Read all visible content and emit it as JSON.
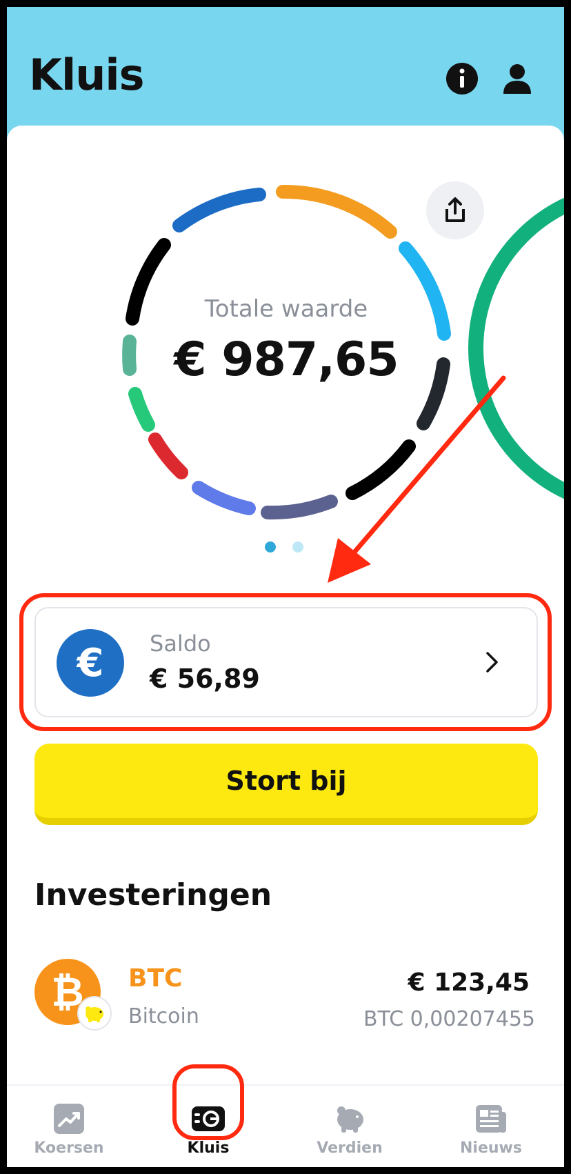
{
  "header": {
    "title": "Kluis",
    "icons": [
      "info-icon",
      "user-icon"
    ]
  },
  "portfolio": {
    "total_label": "Totale waarde",
    "total_value": "€ 987,65",
    "carousel_pages": 2,
    "carousel_active": 1
  },
  "saldo": {
    "label": "Saldo",
    "value": "€ 56,89",
    "currency_symbol": "€"
  },
  "deposit_button": "Stort bij",
  "investments": {
    "title": "Investeringen",
    "items": [
      {
        "symbol": "BTC",
        "name": "Bitcoin",
        "value": "€ 123,45",
        "amount": "BTC 0,00207455",
        "logo_glyph": "₿"
      }
    ]
  },
  "bottom_nav": [
    {
      "label": "Koersen",
      "icon": "chart-icon",
      "active": false
    },
    {
      "label": "Kluis",
      "icon": "wallet-icon",
      "active": true
    },
    {
      "label": "Verdien",
      "icon": "piggy-bank-icon",
      "active": false
    },
    {
      "label": "Nieuws",
      "icon": "newspaper-icon",
      "active": false
    }
  ],
  "colors": {
    "header_bg": "#79d6ef",
    "accent_yellow": "#fde910",
    "annotation_red": "#ff2a10",
    "btc_orange": "#f7931a",
    "euro_blue": "#1f6fc4"
  }
}
